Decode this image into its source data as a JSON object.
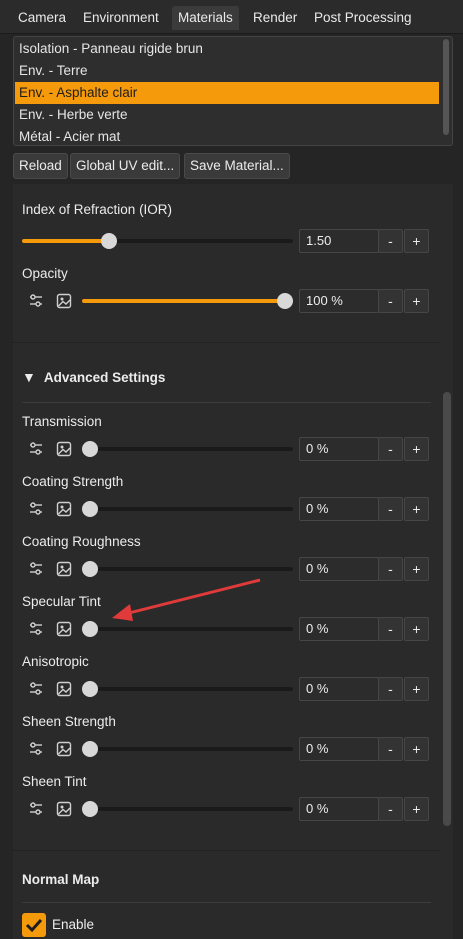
{
  "tabs": [
    {
      "label": "Camera"
    },
    {
      "label": "Environment"
    },
    {
      "label": "Materials",
      "active": true
    },
    {
      "label": "Render"
    },
    {
      "label": "Post Processing"
    }
  ],
  "materials": [
    "Isolation - Panneau rigide brun",
    "Env. - Terre",
    "Env. - Asphalte clair",
    "Env. - Herbe verte",
    "Métal - Acier mat"
  ],
  "selected_material_index": 2,
  "buttons": {
    "reload": "Reload",
    "global_uv": "Global UV edit...",
    "save_material": "Save Material..."
  },
  "ior": {
    "label": "Index of Refraction (IOR)",
    "value": "1.50",
    "fraction": 0.32
  },
  "opacity": {
    "label": "Opacity",
    "value": "100 %",
    "fraction": 1.0
  },
  "advanced": {
    "title": "Advanced Settings",
    "arrow_glyph": "▼",
    "sliders": [
      {
        "label": "Transmission",
        "value": "0 %",
        "fraction": 0
      },
      {
        "label": "Coating Strength",
        "value": "0 %",
        "fraction": 0
      },
      {
        "label": "Coating Roughness",
        "value": "0 %",
        "fraction": 0
      },
      {
        "label": "Specular Tint",
        "value": "0 %",
        "fraction": 0
      },
      {
        "label": "Anisotropic",
        "value": "0 %",
        "fraction": 0
      },
      {
        "label": "Sheen Strength",
        "value": "0 %",
        "fraction": 0
      },
      {
        "label": "Sheen Tint",
        "value": "0 %",
        "fraction": 0
      }
    ]
  },
  "normal_map": {
    "title": "Normal Map",
    "enable_label": "Enable",
    "enabled": true
  },
  "stepper": {
    "minus": "-",
    "plus": "+"
  },
  "colors": {
    "accent": "#f59a0b",
    "annotation_arrow": "#e03a3a"
  }
}
